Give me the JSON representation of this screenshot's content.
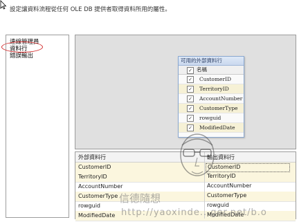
{
  "description": "設定讓資料流程從任何 OLE DB 提供者取得資料所用的屬性。",
  "nav": {
    "items": [
      {
        "label": "連線管理員"
      },
      {
        "label": "資料行"
      },
      {
        "label": "錯誤輸出"
      }
    ],
    "selected_index": 1
  },
  "column_window": {
    "title": "可用的外部資料行",
    "header": "名稱",
    "rows": [
      {
        "name": "CustomerID",
        "checked": true
      },
      {
        "name": "TerritoryID",
        "checked": true
      },
      {
        "name": "AccountNumber",
        "checked": true
      },
      {
        "name": "CustomerType",
        "checked": true
      },
      {
        "name": "rowguid",
        "checked": true
      },
      {
        "name": "ModifiedDate",
        "checked": true
      }
    ]
  },
  "grid": {
    "headers": [
      "外部資料行",
      "輸出資料行"
    ],
    "rows": [
      {
        "external": "CustomerID",
        "output": "CustomerID"
      },
      {
        "external": "TerritoryID",
        "output": "TerritoryID"
      },
      {
        "external": "AccountNumber",
        "output": "AccountNumber"
      },
      {
        "external": "CustomerType",
        "output": "CustomerType"
      },
      {
        "external": "rowguid",
        "output": "rowguid"
      },
      {
        "external": "ModifiedDate",
        "output": "ModifiedDate"
      }
    ]
  },
  "watermark": {
    "name": "信德隨想",
    "url": "http://yaoxinde...ger.net/b.o"
  },
  "colors": {
    "annotation": "#d22a2a",
    "selected_row": "#fbf6de",
    "window_title": "#c9d8ee"
  }
}
